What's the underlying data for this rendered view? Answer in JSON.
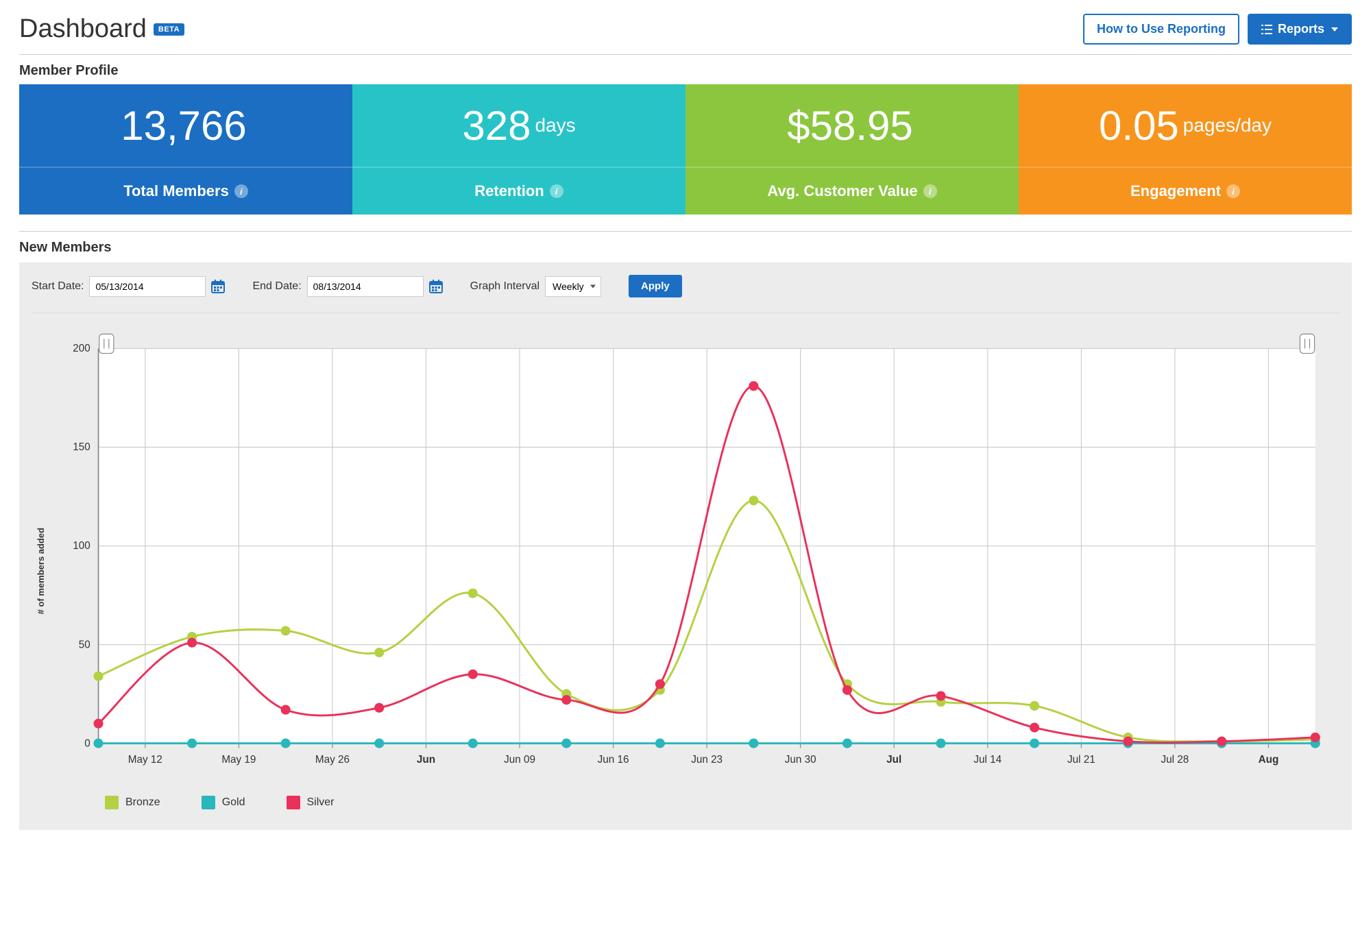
{
  "header": {
    "title": "Dashboard",
    "badge": "BETA",
    "how_to_btn": "How to Use Reporting",
    "reports_btn": "Reports"
  },
  "member_profile": {
    "heading": "Member Profile",
    "tiles": [
      {
        "value": "13,766",
        "unit": "",
        "label": "Total Members",
        "color": "blue"
      },
      {
        "value": "328",
        "unit": "days",
        "label": "Retention",
        "color": "teal"
      },
      {
        "value": "$58.95",
        "unit": "",
        "label": "Avg. Customer Value",
        "color": "green"
      },
      {
        "value": "0.05",
        "unit": "pages/day",
        "label": "Engagement",
        "color": "orange"
      }
    ]
  },
  "new_members": {
    "heading": "New Members",
    "filters": {
      "start_label": "Start Date:",
      "start_value": "05/13/2014",
      "end_label": "End Date:",
      "end_value": "08/13/2014",
      "interval_label": "Graph Interval",
      "interval_value": "Weekly",
      "apply_label": "Apply"
    },
    "chart_ylabel": "# of members added"
  },
  "chart_data": {
    "type": "line",
    "ylabel": "# of members added",
    "ylim": [
      0,
      200
    ],
    "yticks": [
      0,
      50,
      100,
      150,
      200
    ],
    "categories": [
      "May 12",
      "May 19",
      "May 26",
      "Jun",
      "Jun 09",
      "Jun 16",
      "Jun 23",
      "Jun 30",
      "Jul",
      "Jul 14",
      "Jul 21",
      "Jul 28",
      "Aug"
    ],
    "category_bold": [
      false,
      false,
      false,
      true,
      false,
      false,
      false,
      false,
      true,
      false,
      false,
      false,
      true
    ],
    "series": [
      {
        "name": "Bronze",
        "color": "#b4d143",
        "values": [
          34,
          54,
          57,
          46,
          76,
          25,
          27,
          123,
          30,
          21,
          19,
          3,
          1,
          2
        ]
      },
      {
        "name": "Gold",
        "color": "#2ab7bb",
        "values": [
          0,
          0,
          0,
          0,
          0,
          0,
          0,
          0,
          0,
          0,
          0,
          0,
          0,
          0
        ]
      },
      {
        "name": "Silver",
        "color": "#e9315a",
        "values": [
          10,
          51,
          17,
          18,
          35,
          22,
          30,
          181,
          27,
          24,
          8,
          1,
          1,
          3
        ]
      }
    ],
    "x_positions": [
      0,
      1,
      2,
      3,
      4,
      5,
      6,
      7,
      8,
      9,
      10,
      11,
      12,
      13
    ]
  },
  "colors": {
    "blue": "#1b6ec2",
    "teal": "#28c3c7",
    "green": "#8cc63f",
    "orange": "#f7941e",
    "bronze": "#b4d143",
    "gold": "#2ab7bb",
    "silver": "#e9315a"
  }
}
